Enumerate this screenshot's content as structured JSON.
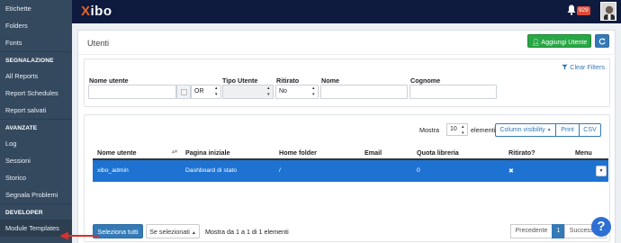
{
  "sidebar": {
    "items_top": [
      {
        "label": "Etichette"
      },
      {
        "label": "Folders"
      },
      {
        "label": "Fonts"
      }
    ],
    "sections": [
      {
        "title": "SEGNALAZIONE",
        "items": [
          {
            "label": "All Reports"
          },
          {
            "label": "Report Schedules"
          },
          {
            "label": "Report salvati"
          }
        ]
      },
      {
        "title": "AVANZATE",
        "items": [
          {
            "label": "Log"
          },
          {
            "label": "Sessioni"
          },
          {
            "label": "Storico"
          },
          {
            "label": "Segnala Problemi"
          }
        ]
      },
      {
        "title": "DEVELOPER",
        "items": [
          {
            "label": "Module Templates"
          }
        ]
      }
    ]
  },
  "topbar": {
    "logo_x": "X",
    "logo_rest": "ibo",
    "notification_count": "929"
  },
  "page": {
    "title": "Utenti",
    "add_button": "Aggiungi Utente",
    "refresh_icon": "refresh-icon"
  },
  "filters": {
    "clear_label": "Clear Filters",
    "username_label": "Nome utente",
    "username_value": "",
    "logic_value": "OR",
    "usertype_label": "Tipo Utente",
    "usertype_value": "",
    "retired_label": "Ritirato",
    "retired_value": "No",
    "firstname_label": "Nome",
    "lastname_label": "Cognome"
  },
  "table": {
    "show_label": "Mostra",
    "page_length": "10",
    "entries_label": "elementi",
    "colvis_button": "Column visibility",
    "print_button": "Print",
    "csv_button": "CSV",
    "columns": [
      "Nome utente",
      "Pagina iniziale",
      "Home folder",
      "Email",
      "Quota libreria",
      "Ritirato?",
      "Menu"
    ],
    "rows": [
      {
        "username": "xibo_admin",
        "homepage": "Dashboard di stato",
        "folder": "/",
        "email": "",
        "quota": "0",
        "retired": "✖"
      }
    ],
    "select_all": "Seleziona tutti",
    "with_selected": "Se selezionati",
    "info": "Mostra da 1 a 1 di 1 elementi",
    "prev": "Precedente",
    "page": "1",
    "next": "Successivo"
  },
  "colors": {
    "sidebar": "#34495e",
    "topbar": "#0e1b3f",
    "accent": "#337ab7",
    "success": "#28a745",
    "selected_row": "#1e73d2"
  }
}
